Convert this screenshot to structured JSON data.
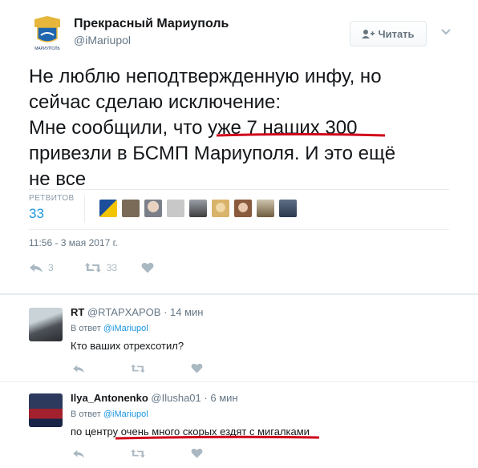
{
  "tweet": {
    "author_name": "Прекрасный Мариуполь",
    "author_handle": "@iMariupol",
    "avatar_text": "МАРИУПОЛЬ",
    "follow_label": "Читать",
    "text_lines": [
      "Не люблю неподтвержденную инфу, но",
      "сейчас сделаю исключение:",
      "Мне сообщили, что уже 7 наших 300",
      "привезли в БСМП Мариуполя. И это ещё",
      "не все"
    ],
    "retweets_label": "РЕТВИТОВ",
    "retweets_count": "33",
    "timestamp": "11:56 - 3 мая 2017 г.",
    "reply_count": "3",
    "retweet_count": "33",
    "underline_color": "#d0021b"
  },
  "replies": [
    {
      "name": "RT",
      "handle": "@RTAPXAPOB",
      "time": "· 14 мин",
      "in_reply_prefix": "В ответ",
      "in_reply_to": "@iMariupol",
      "text": "Кто ваших отрехсотил?"
    },
    {
      "name": "Ilya_Antonenko",
      "handle": "@Ilusha01",
      "time": "· 6 мин",
      "in_reply_prefix": "В ответ",
      "in_reply_to": "@iMariupol",
      "text": "по центру очень много скорых ездят с мигалками"
    }
  ],
  "colors": {
    "accent": "#1b95e0",
    "muted": "#657786",
    "icon": "#aab8c2",
    "highlight": "#d0021b"
  },
  "icons": [
    "add-user-icon",
    "chevron-down-icon",
    "reply-icon",
    "retweet-icon",
    "like-icon"
  ]
}
